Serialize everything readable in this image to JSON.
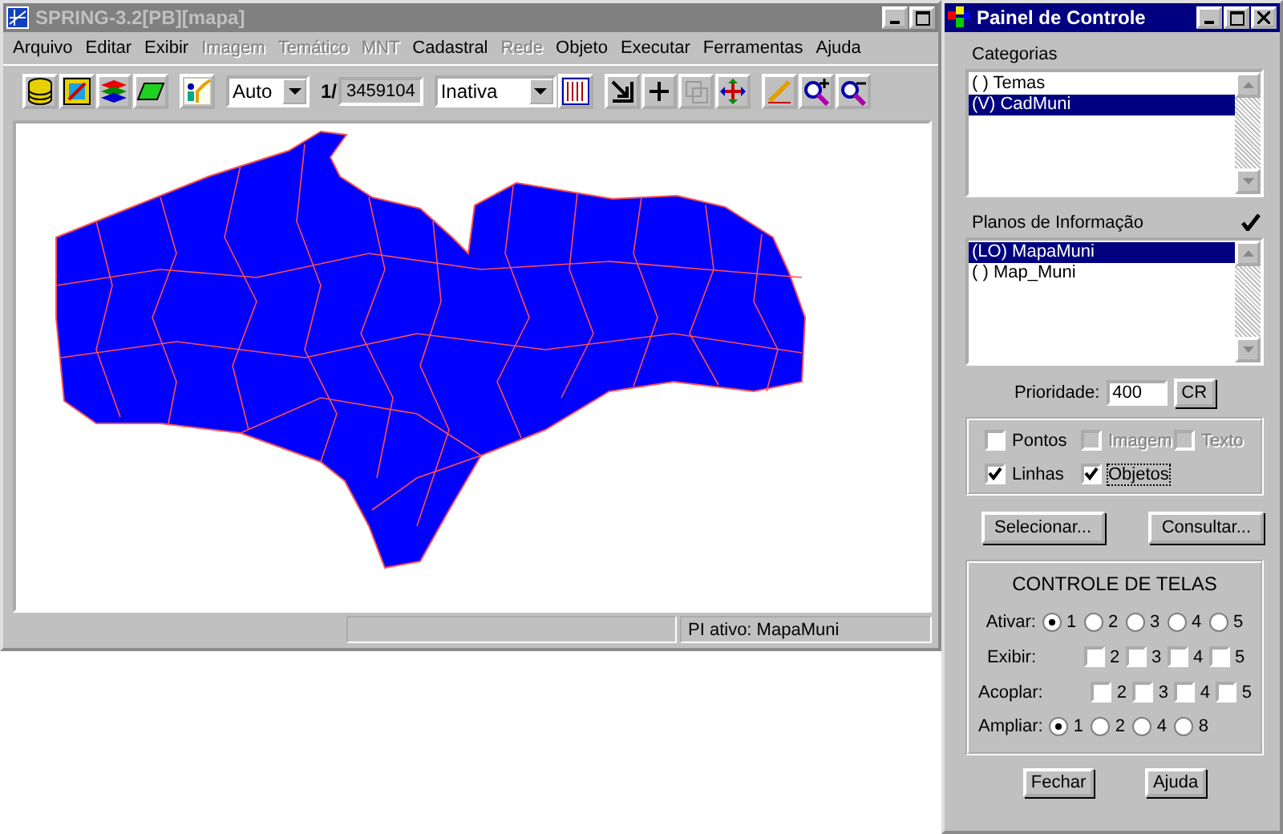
{
  "main_window": {
    "title": "SPRING-3.2[PB][mapa]",
    "menu": [
      {
        "label": "Arquivo",
        "disabled": false
      },
      {
        "label": "Editar",
        "disabled": false
      },
      {
        "label": "Exibir",
        "disabled": false
      },
      {
        "label": "Imagem",
        "disabled": true
      },
      {
        "label": "Temático",
        "disabled": true
      },
      {
        "label": "MNT",
        "disabled": true
      },
      {
        "label": "Cadastral",
        "disabled": false
      },
      {
        "label": "Rede",
        "disabled": true
      },
      {
        "label": "Objeto",
        "disabled": false
      },
      {
        "label": "Executar",
        "disabled": false
      },
      {
        "label": "Ferramentas",
        "disabled": false
      },
      {
        "label": "Ajuda",
        "disabled": false
      }
    ],
    "toolbar": {
      "scale_mode": "Auto",
      "scale_prefix": "1/",
      "scale": "3459104",
      "cursor_mode": "Inativa"
    },
    "status_bar": {
      "pane_2": "PI ativo: MapaMuni"
    }
  },
  "control_panel": {
    "title": "Painel de Controle",
    "categories_label": "Categorias",
    "categories": [
      {
        "label": "( ) Temas",
        "selected": false
      },
      {
        "label": "(V) CadMuni",
        "selected": true
      }
    ],
    "planes_label": "Planos de Informação",
    "planes_checked": true,
    "planes": [
      {
        "label": "(LO) MapaMuni",
        "selected": true
      },
      {
        "label": "( ) Map_Muni",
        "selected": false
      }
    ],
    "priority_label": "Prioridade:",
    "priority": "400",
    "priority_button": "CR",
    "layers": [
      {
        "label": "Pontos",
        "checked": false,
        "disabled": false,
        "focused": false
      },
      {
        "label": "Imagem",
        "checked": false,
        "disabled": true,
        "focused": false
      },
      {
        "label": "Texto",
        "checked": false,
        "disabled": true,
        "focused": false
      },
      {
        "label": "Linhas",
        "checked": true,
        "disabled": false,
        "focused": false
      },
      {
        "label": "Objetos",
        "checked": true,
        "disabled": false,
        "focused": true
      }
    ],
    "actions": [
      "Selecionar...",
      "Consultar..."
    ],
    "screens": {
      "title": "CONTROLE DE TELAS",
      "rows": [
        {
          "label": "Ativar:",
          "kind": "radio",
          "options": [
            {
              "label": "1",
              "selected": true
            },
            {
              "label": "2",
              "selected": false
            },
            {
              "label": "3",
              "selected": false
            },
            {
              "label": "4",
              "selected": false
            },
            {
              "label": "5",
              "selected": false
            }
          ]
        },
        {
          "label": "Exibir:",
          "kind": "check",
          "options": [
            {
              "label": "2",
              "selected": false
            },
            {
              "label": "3",
              "selected": false
            },
            {
              "label": "4",
              "selected": false
            },
            {
              "label": "5",
              "selected": false
            }
          ]
        },
        {
          "label": "Acoplar:",
          "kind": "check",
          "options": [
            {
              "label": "2",
              "selected": false
            },
            {
              "label": "3",
              "selected": false
            },
            {
              "label": "4",
              "selected": false
            },
            {
              "label": "5",
              "selected": false
            }
          ]
        },
        {
          "label": "Ampliar:",
          "kind": "radio",
          "options": [
            {
              "label": "1",
              "selected": true
            },
            {
              "label": "2",
              "selected": false
            },
            {
              "label": "4",
              "selected": false
            },
            {
              "label": "8",
              "selected": false
            }
          ]
        }
      ]
    },
    "footer_buttons": [
      "Fechar",
      "Ajuda"
    ]
  }
}
